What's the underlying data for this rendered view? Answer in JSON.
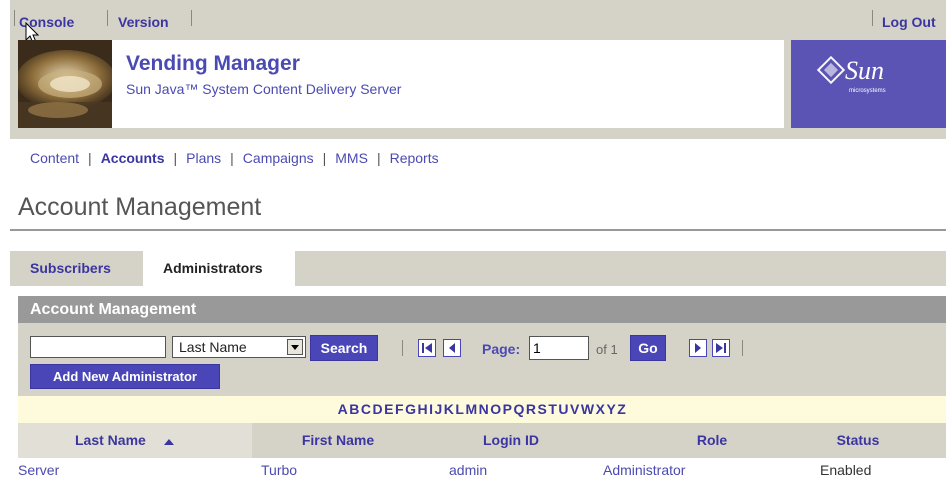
{
  "utility_bar": {
    "console_label": "Console",
    "version_label": "Version",
    "logout_label": "Log Out"
  },
  "brand": {
    "title": "Vending Manager",
    "subtitle": "Sun Java™ System Content Delivery Server",
    "logo_text": "Sun",
    "logo_sub": "microsystems"
  },
  "nav": {
    "items": [
      {
        "label": "Content",
        "active": false
      },
      {
        "label": "Accounts",
        "active": true
      },
      {
        "label": "Plans",
        "active": false
      },
      {
        "label": "Campaigns",
        "active": false
      },
      {
        "label": "MMS",
        "active": false
      },
      {
        "label": "Reports",
        "active": false
      }
    ]
  },
  "page": {
    "title": "Account Management"
  },
  "tabs": [
    {
      "label": "Subscribers",
      "selected": false
    },
    {
      "label": "Administrators",
      "selected": true
    }
  ],
  "panel": {
    "title": "Account Management",
    "search_value": "",
    "select_value": "Last Name",
    "search_button": "Search",
    "page_label": "Page:",
    "page_value": "1",
    "of_text": "of 1",
    "go_button": "Go",
    "add_button": "Add New Administrator"
  },
  "alphabet": [
    "A",
    "B",
    "C",
    "D",
    "E",
    "F",
    "G",
    "H",
    "I",
    "J",
    "K",
    "L",
    "M",
    "N",
    "O",
    "P",
    "Q",
    "R",
    "S",
    "T",
    "U",
    "V",
    "W",
    "X",
    "Y",
    "Z"
  ],
  "table": {
    "columns": [
      "Last Name",
      "First Name",
      "Login ID",
      "Role",
      "Status"
    ],
    "sort_column": "Last Name",
    "sort_direction": "ascending",
    "rows": [
      {
        "last_name": "Server",
        "first_name": "Turbo",
        "login_id": "admin",
        "role": "Administrator",
        "status": "Enabled"
      }
    ]
  },
  "colors": {
    "accent": "#4b46b8",
    "link": "#4b4ab2",
    "band": "#d5d3c8",
    "panel_header": "#999999",
    "alpha_bg": "#fdfbdb",
    "sun_logo_bg": "#5c54b4"
  },
  "icons": {
    "cursor": "mouse-pointer-icon",
    "sort": "sort-ascending-icon",
    "first_page": "first-page-icon",
    "prev_page": "previous-page-icon",
    "next_page": "next-page-icon",
    "last_page": "last-page-icon",
    "dropdown": "chevron-down-icon"
  }
}
